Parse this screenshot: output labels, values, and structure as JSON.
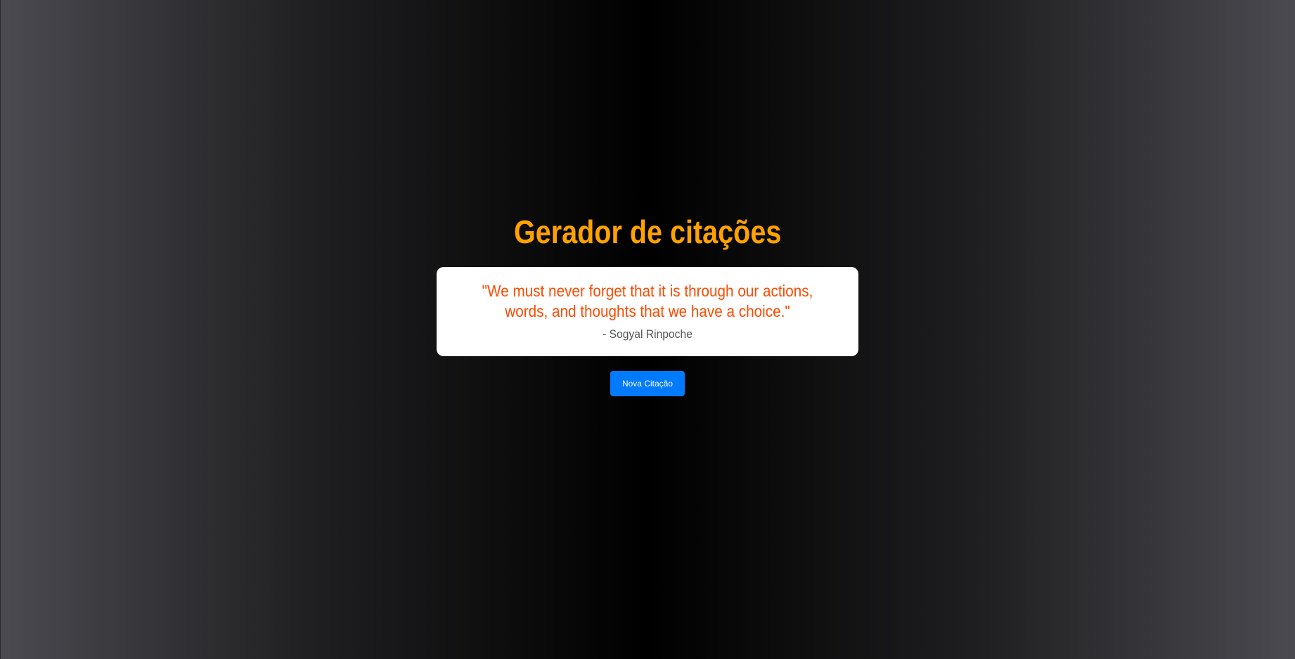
{
  "app": {
    "title": "Gerador de citações"
  },
  "quote": {
    "text": "\"We must never forget that it is through our actions, words, and thoughts that we have a choice.\"",
    "author": "- Sogyal Rinpoche"
  },
  "actions": {
    "new_quote_label": "Nova Citação"
  },
  "colors": {
    "title": "#ffa200",
    "quote_text": "#ff4a00",
    "author_text": "#555555",
    "button_bg": "#007bff",
    "card_bg": "#ffffff"
  }
}
